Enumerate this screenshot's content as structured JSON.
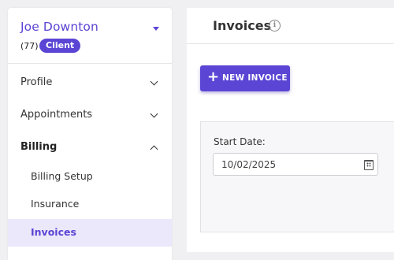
{
  "client": {
    "name": "Joe Downton",
    "count": "(77)",
    "badge": "Client"
  },
  "sidebar": {
    "items": [
      {
        "label": "Profile",
        "expanded": false
      },
      {
        "label": "Appointments",
        "expanded": false
      },
      {
        "label": "Billing",
        "expanded": true
      }
    ],
    "billing_subitems": [
      {
        "label": "Billing Setup",
        "active": false
      },
      {
        "label": "Insurance",
        "active": false
      },
      {
        "label": "Invoices",
        "active": true
      }
    ]
  },
  "header": {
    "title": "Invoices",
    "info_icon": "info-icon"
  },
  "actions": {
    "new_invoice_label": "NEW INVOICE",
    "new_invoice_icon": "+"
  },
  "filters": {
    "start_date_label": "Start Date:",
    "start_date_value": "10/02/2025",
    "start_date_icon": "calendar-icon"
  },
  "colors": {
    "accent": "#5b45d4",
    "active_bg": "#ebe8fb"
  }
}
